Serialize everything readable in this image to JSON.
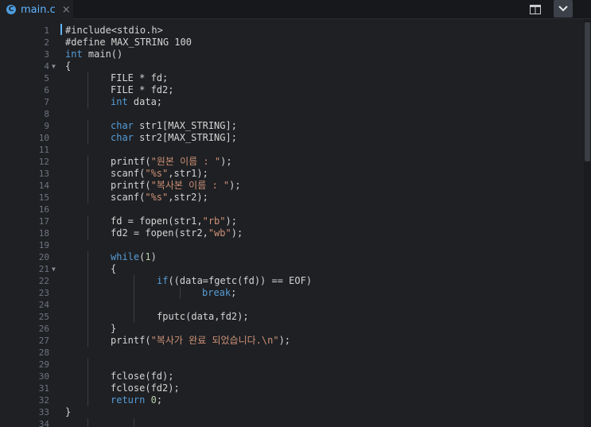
{
  "tab": {
    "title": "main.c",
    "close_glyph": "×",
    "icon": "c-file-icon"
  },
  "toolbar": {
    "split_icon": "split-view-icon",
    "menu_icon": "chevron-down-icon"
  },
  "colors": {
    "keyword": "#569cd6",
    "string": "#ce9178",
    "number": "#b5cea8",
    "text": "#d4d4d4",
    "accent": "#5fb3ff"
  },
  "editor": {
    "lines": [
      {
        "n": "1",
        "indent": 0,
        "parts": [
          [
            "t",
            "#include<stdio.h>"
          ]
        ]
      },
      {
        "n": "2",
        "indent": 0,
        "parts": [
          [
            "t",
            "#define MAX_STRING 100"
          ]
        ]
      },
      {
        "n": "3",
        "indent": 0,
        "parts": [
          [
            "k",
            "int"
          ],
          [
            "t",
            " main()"
          ]
        ]
      },
      {
        "n": "4",
        "indent": 0,
        "fold": true,
        "parts": [
          [
            "t",
            "{"
          ]
        ]
      },
      {
        "n": "5",
        "indent": 1,
        "parts": [
          [
            "t",
            "FILE * fd;"
          ]
        ]
      },
      {
        "n": "6",
        "indent": 1,
        "parts": [
          [
            "t",
            "FILE * fd2;"
          ]
        ]
      },
      {
        "n": "7",
        "indent": 1,
        "parts": [
          [
            "k",
            "int"
          ],
          [
            "t",
            " data;"
          ]
        ]
      },
      {
        "n": "8",
        "indent": 0,
        "parts": []
      },
      {
        "n": "9",
        "indent": 1,
        "parts": [
          [
            "k",
            "char"
          ],
          [
            "t",
            " str1[MAX_STRING];"
          ]
        ]
      },
      {
        "n": "10",
        "indent": 1,
        "parts": [
          [
            "k",
            "char"
          ],
          [
            "t",
            " str2[MAX_STRING];"
          ]
        ]
      },
      {
        "n": "11",
        "indent": 0,
        "parts": []
      },
      {
        "n": "12",
        "indent": 1,
        "parts": [
          [
            "t",
            "printf("
          ],
          [
            "s",
            "\"원본 이름 : \""
          ],
          [
            "t",
            ");"
          ]
        ]
      },
      {
        "n": "13",
        "indent": 1,
        "parts": [
          [
            "t",
            "scanf("
          ],
          [
            "s",
            "\"%s\""
          ],
          [
            "t",
            ",str1);"
          ]
        ]
      },
      {
        "n": "14",
        "indent": 1,
        "parts": [
          [
            "t",
            "printf("
          ],
          [
            "s",
            "\"복사본 이름 : \""
          ],
          [
            "t",
            ");"
          ]
        ]
      },
      {
        "n": "15",
        "indent": 1,
        "parts": [
          [
            "t",
            "scanf("
          ],
          [
            "s",
            "\"%s\""
          ],
          [
            "t",
            ",str2);"
          ]
        ]
      },
      {
        "n": "16",
        "indent": 0,
        "parts": []
      },
      {
        "n": "17",
        "indent": 1,
        "parts": [
          [
            "t",
            "fd = fopen(str1,"
          ],
          [
            "s",
            "\"rb\""
          ],
          [
            "t",
            ");"
          ]
        ]
      },
      {
        "n": "18",
        "indent": 1,
        "parts": [
          [
            "t",
            "fd2 = fopen(str2,"
          ],
          [
            "s",
            "\"wb\""
          ],
          [
            "t",
            ");"
          ]
        ]
      },
      {
        "n": "19",
        "indent": 0,
        "parts": []
      },
      {
        "n": "20",
        "indent": 1,
        "parts": [
          [
            "k",
            "while"
          ],
          [
            "t",
            "("
          ],
          [
            "n",
            "1"
          ],
          [
            "t",
            ")"
          ]
        ]
      },
      {
        "n": "21",
        "indent": 1,
        "fold": true,
        "parts": [
          [
            "t",
            "{"
          ]
        ]
      },
      {
        "n": "22",
        "indent": 2,
        "parts": [
          [
            "k",
            "if"
          ],
          [
            "t",
            "((data=fgetc(fd)) == EOF)"
          ]
        ]
      },
      {
        "n": "23",
        "indent": 3,
        "parts": [
          [
            "k",
            "break"
          ],
          [
            "t",
            ";"
          ]
        ]
      },
      {
        "n": "24",
        "indent": 0,
        "parts": []
      },
      {
        "n": "25",
        "indent": 2,
        "parts": [
          [
            "t",
            "fputc(data,fd2);"
          ]
        ]
      },
      {
        "n": "26",
        "indent": 1,
        "parts": [
          [
            "t",
            "}"
          ]
        ]
      },
      {
        "n": "27",
        "indent": 1,
        "parts": [
          [
            "t",
            "printf("
          ],
          [
            "s",
            "\"복사가 완료 되었습니다.\\n\""
          ],
          [
            "t",
            ");"
          ]
        ]
      },
      {
        "n": "28",
        "indent": 0,
        "parts": []
      },
      {
        "n": "29",
        "indent": 0,
        "parts": []
      },
      {
        "n": "30",
        "indent": 1,
        "parts": [
          [
            "t",
            "fclose(fd);"
          ]
        ]
      },
      {
        "n": "31",
        "indent": 1,
        "parts": [
          [
            "t",
            "fclose(fd2);"
          ]
        ]
      },
      {
        "n": "32",
        "indent": 1,
        "parts": [
          [
            "k",
            "return"
          ],
          [
            "t",
            " "
          ],
          [
            "n",
            "0"
          ],
          [
            "t",
            ";"
          ]
        ]
      },
      {
        "n": "33",
        "indent": 0,
        "parts": [
          [
            "t",
            "}"
          ]
        ]
      },
      {
        "n": "34",
        "indent": 0,
        "parts": []
      }
    ]
  }
}
